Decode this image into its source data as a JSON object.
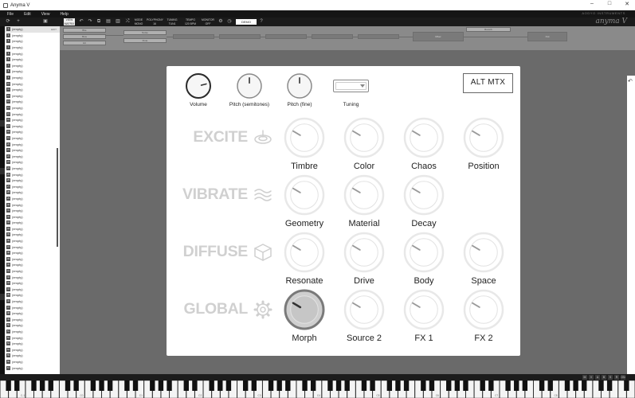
{
  "window": {
    "title": "Anyma V",
    "controls": [
      "–",
      "□",
      "✕"
    ]
  },
  "menubar": {
    "items": [
      "File",
      "Edit",
      "View",
      "Help"
    ],
    "brand": "AODYO INSTRUMENTS",
    "logo": "anyma V"
  },
  "toolbar": {
    "view_line1": "VIEW",
    "view_line2": "MATRIX",
    "mode_line1": "MODE",
    "mode_line2": "MONO",
    "poly_line1": "POLYPHONY",
    "poly_line2": "16",
    "tuning_line1": "TUNING",
    "tuning_line2": "TUN1",
    "tempo_line1": "TEMPO",
    "tempo_line2": "120 BPM",
    "monitor_line1": "MONITOR",
    "monitor_line2": "OFF",
    "demo_label": "DEMO"
  },
  "presets": {
    "items": [
      {
        "num": "1",
        "label": "(empty)",
        "right": "EDIT"
      },
      {
        "num": "2",
        "label": "(empty)"
      },
      {
        "num": "3",
        "label": "(empty)"
      },
      {
        "num": "4",
        "label": "(empty)"
      },
      {
        "num": "5",
        "label": "(empty)"
      },
      {
        "num": "6",
        "label": "(empty)"
      },
      {
        "num": "7",
        "label": "(empty)"
      },
      {
        "num": "8",
        "label": "(empty)"
      },
      {
        "num": "9",
        "label": "(empty)"
      },
      {
        "num": "10",
        "label": "(empty)"
      },
      {
        "num": "11",
        "label": "(empty)"
      },
      {
        "num": "12",
        "label": "(empty)"
      },
      {
        "num": "13",
        "label": "(empty)"
      },
      {
        "num": "14",
        "label": "(empty)"
      },
      {
        "num": "15",
        "label": "(empty)"
      },
      {
        "num": "16",
        "label": "(empty)"
      },
      {
        "num": "17",
        "label": "(empty)"
      },
      {
        "num": "18",
        "label": "(empty)"
      },
      {
        "num": "19",
        "label": "(empty)"
      },
      {
        "num": "20",
        "label": "(empty)"
      },
      {
        "num": "21",
        "label": "(empty)"
      },
      {
        "num": "22",
        "label": "(empty)"
      },
      {
        "num": "23",
        "label": "(empty)"
      },
      {
        "num": "24",
        "label": "(empty)"
      },
      {
        "num": "25",
        "label": "(empty)"
      },
      {
        "num": "26",
        "label": "(empty)"
      },
      {
        "num": "27",
        "label": "(empty)"
      },
      {
        "num": "28",
        "label": "(empty)"
      },
      {
        "num": "29",
        "label": "(empty)"
      },
      {
        "num": "30",
        "label": "(empty)"
      },
      {
        "num": "31",
        "label": "(empty)"
      },
      {
        "num": "32",
        "label": "(empty)"
      },
      {
        "num": "33",
        "label": "(empty)"
      },
      {
        "num": "34",
        "label": "(empty)"
      },
      {
        "num": "35",
        "label": "(empty)"
      },
      {
        "num": "36",
        "label": "(empty)"
      },
      {
        "num": "37",
        "label": "(empty)"
      },
      {
        "num": "38",
        "label": "(empty)"
      },
      {
        "num": "39",
        "label": "(empty)"
      },
      {
        "num": "40",
        "label": "(empty)"
      },
      {
        "num": "41",
        "label": "(empty)"
      },
      {
        "num": "42",
        "label": "(empty)"
      },
      {
        "num": "43",
        "label": "(empty)"
      },
      {
        "num": "44",
        "label": "(empty)"
      },
      {
        "num": "45",
        "label": "(empty)"
      },
      {
        "num": "46",
        "label": "(empty)"
      },
      {
        "num": "47",
        "label": "(empty)"
      },
      {
        "num": "48",
        "label": "(empty)"
      },
      {
        "num": "49",
        "label": "(empty)"
      },
      {
        "num": "50",
        "label": "(empty)"
      },
      {
        "num": "51",
        "label": "(empty)"
      },
      {
        "num": "52",
        "label": "(empty)"
      },
      {
        "num": "53",
        "label": "(empty)"
      },
      {
        "num": "54",
        "label": "(empty)"
      },
      {
        "num": "55",
        "label": "(empty)"
      },
      {
        "num": "56",
        "label": "(empty)"
      },
      {
        "num": "57",
        "label": "(empty)"
      }
    ]
  },
  "chain": {
    "mods": [
      "Bite",
      "Noise",
      "Flute",
      "Mixer",
      "Out",
      "Reverb"
    ],
    "minor": [
      "Blow",
      "Bow",
      "Hit"
    ]
  },
  "top_knobs": [
    {
      "label": "Volume",
      "value": 0.78
    },
    {
      "label": "Pitch (semitones)",
      "value": 0.5
    },
    {
      "label": "Pitch (fine)",
      "value": 0.5
    }
  ],
  "tuning": {
    "label": "Tuning",
    "value": ""
  },
  "alt_button": "ALT MTX",
  "sections": [
    {
      "name": "EXCITE",
      "icon": "excite-icon",
      "knobs": [
        {
          "label": "Timbre",
          "value": 0.28
        },
        {
          "label": "Color",
          "value": 0.28
        },
        {
          "label": "Chaos",
          "value": 0.28
        },
        {
          "label": "Position",
          "value": 0.28
        }
      ]
    },
    {
      "name": "VIBRATE",
      "icon": "wave-icon",
      "knobs": [
        {
          "label": "Geometry",
          "value": 0.28
        },
        {
          "label": "Material",
          "value": 0.28
        },
        {
          "label": "Decay",
          "value": 0.28
        }
      ]
    },
    {
      "name": "DIFFUSE",
      "icon": "cube-icon",
      "knobs": [
        {
          "label": "Resonate",
          "value": 0.28
        },
        {
          "label": "Drive",
          "value": 0.28
        },
        {
          "label": "Body",
          "value": 0.28
        },
        {
          "label": "Space",
          "value": 0.28
        }
      ]
    },
    {
      "name": "GLOBAL",
      "icon": "gear-icon",
      "knobs": [
        {
          "label": "Morph",
          "value": 0.28,
          "active": true
        },
        {
          "label": "Source 2",
          "value": 0.28
        },
        {
          "label": "FX 1",
          "value": 0.28
        },
        {
          "label": "FX 2",
          "value": 0.28
        }
      ]
    }
  ],
  "keyboard": {
    "controls": [
      "M",
      "V",
      "A",
      "B",
      "S",
      "R",
      "ON"
    ],
    "octave_labels": [
      "C-1",
      "C0",
      "C1",
      "C2",
      "C3",
      "C4",
      "C5",
      "C6",
      "C7",
      "C8"
    ]
  },
  "colors": {
    "panel_bg": "#ffffff",
    "app_bg": "#6a6a6a",
    "section_text": "#d0d0d0",
    "knob_ring": "#e6e6e6"
  }
}
